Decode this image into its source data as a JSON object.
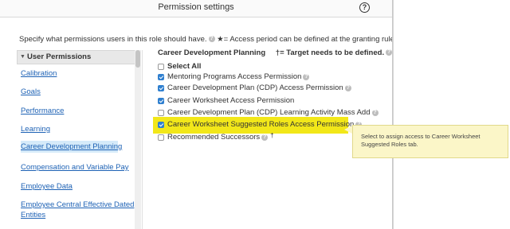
{
  "dialog": {
    "title": "Permission settings",
    "help_icon": "?"
  },
  "intro": {
    "text": "Specify what permissions users in this role should have.",
    "star_note": "★= Access period can be defined at the granting rule level."
  },
  "sidebar": {
    "header": "User Permissions",
    "items": [
      {
        "label": "Calibration"
      },
      {
        "label": "Goals"
      },
      {
        "label": "Performance"
      },
      {
        "label": "Learning"
      },
      {
        "label": "Career Development Planning"
      },
      {
        "label": "Compensation and Variable Pay"
      },
      {
        "label": "Employee Data"
      },
      {
        "label": "Employee Central Effective Dated"
      },
      {
        "label": "Entities"
      }
    ]
  },
  "main": {
    "section_title": "Career Development Planning",
    "target_note": "†= Target needs to be defined.",
    "select_all": "Select All",
    "permissions": [
      {
        "label": "Mentoring Programs Access Permission",
        "checked": true
      },
      {
        "label": "Career Development Plan (CDP) Access Permission",
        "checked": true
      },
      {
        "label": "Career Worksheet Access Permission",
        "checked": true
      },
      {
        "label": "Career Development Plan (CDP) Learning Activity Mass Add",
        "checked": false
      },
      {
        "label": "Career Worksheet Suggested Roles Access Permission",
        "checked": true
      },
      {
        "label": "Recommended Successors",
        "checked": false
      }
    ],
    "dagger": "†"
  },
  "tooltip": {
    "text": "Select to assign access to Career Worksheet Suggested Roles tab."
  },
  "colors": {
    "link": "#1e62b5",
    "highlight": "#f1e400",
    "checkbox": "#2f7fcf",
    "tooltip_bg": "#fbf6c8"
  }
}
